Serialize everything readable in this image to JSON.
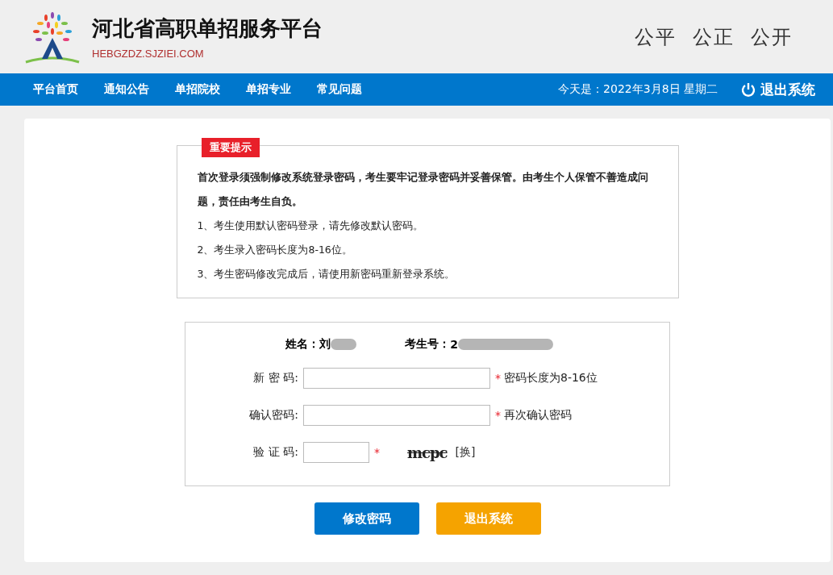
{
  "header": {
    "title": "河北省高职单招服务平台",
    "domain": "HEBGZDZ.SJZIEI.COM",
    "slogan": [
      "公平",
      "公正",
      "公开"
    ]
  },
  "nav": {
    "items": [
      {
        "label": "平台首页"
      },
      {
        "label": "通知公告"
      },
      {
        "label": "单招院校"
      },
      {
        "label": "单招专业"
      },
      {
        "label": "常见问题"
      }
    ],
    "date": "今天是：2022年3月8日 星期二",
    "logout": "退出系统"
  },
  "notice": {
    "badge": "重要提示",
    "lead": "首次登录须强制修改系统登录密码，考生要牢记登录密码并妥善保管。由考生个人保管不善造成问题，责任由考生自负。",
    "items": [
      "1、考生使用默认密码登录，请先修改默认密码。",
      "2、考生录入密码长度为8-16位。",
      "3、考生密码修改完成后，请使用新密码重新登录系统。"
    ]
  },
  "form": {
    "name_label": "姓名：",
    "name_value": "刘",
    "id_label": "考生号：",
    "id_value": "2",
    "fields": [
      {
        "label": "新 密 码:",
        "kind": "password",
        "mark": "*",
        "hint": "密码长度为8-16位"
      },
      {
        "label": "确认密码:",
        "kind": "password",
        "mark": "*",
        "hint": "再次确认密码"
      },
      {
        "label": "验 证 码:",
        "kind": "captcha",
        "mark": "*",
        "captcha": "mcpc",
        "refresh": "[换]"
      }
    ]
  },
  "buttons": [
    {
      "label": "修改密码",
      "kind": "primary"
    },
    {
      "label": "退出系统",
      "kind": "secondary"
    }
  ]
}
